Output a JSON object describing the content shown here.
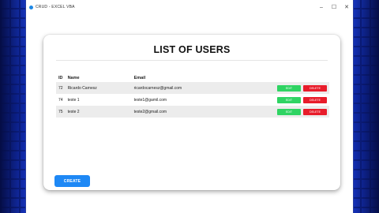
{
  "window": {
    "title": "CRUD - EXCEL VBA",
    "controls": [
      "minimize-icon",
      "maximize-icon",
      "close-icon"
    ],
    "minimize_glyph": "–",
    "maximize_glyph": "☐",
    "close_glyph": "✕"
  },
  "page": {
    "title": "LIST OF USERS",
    "create_label": "CREATE"
  },
  "table": {
    "headers": {
      "id": "ID",
      "name": "Name",
      "email": "Email"
    },
    "rows": [
      {
        "id": "72",
        "name": "Ricardo Carnesz",
        "email": "ricardocarnesz@gmail.com"
      },
      {
        "id": "74",
        "name": "teste 1",
        "email": "teste1@gamil.com"
      },
      {
        "id": "75",
        "name": "teste 2",
        "email": "teste2@gmail.com"
      }
    ],
    "edit_label": "EDIT",
    "delete_label": "DELETE"
  },
  "colors": {
    "edit": "#2fd463",
    "delete": "#e81c2a",
    "create": "#1e88f5",
    "background": "#1530c8"
  }
}
